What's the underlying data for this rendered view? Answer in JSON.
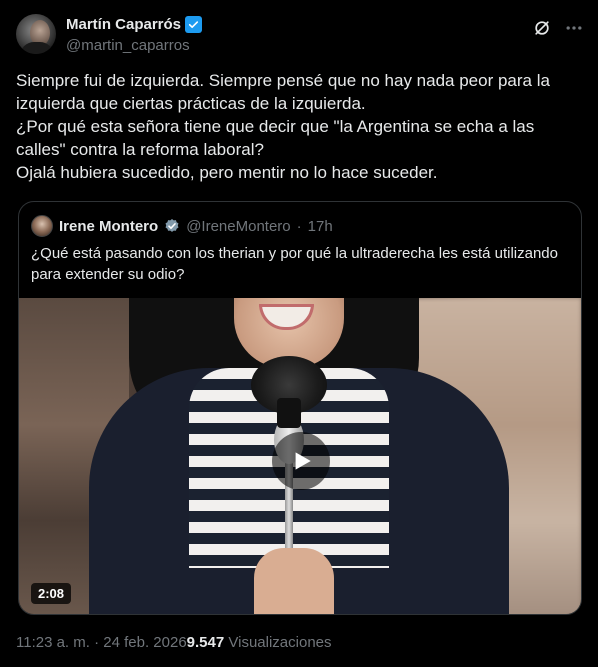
{
  "author": {
    "display_name": "Martín Caparrós",
    "handle": "@martin_caparros"
  },
  "tweet": {
    "lines": [
      "Siempre fui de izquierda. Siempre pensé que no hay nada peor para la izquierda que ciertas prácticas de la izquierda.",
      "¿Por qué esta señora tiene que decir que \"la Argentina se echa a las calles\" contra la reforma laboral?",
      "Ojalá hubiera sucedido, pero mentir no lo hace suceder."
    ]
  },
  "quoted": {
    "display_name": "Irene Montero",
    "handle": "@IreneMontero",
    "separator": "·",
    "time": "17h",
    "text": "¿Qué está pasando con los therian y por qué la ultraderecha les está utilizando para extender su odio?",
    "video": {
      "duration": "2:08"
    }
  },
  "footer": {
    "timestamp": "11:23 a. m. · 24 feb. 2026",
    "views_count": "9.547",
    "views_label": "Visualizaciones"
  },
  "icons": {
    "verified": "verified-badge-icon",
    "grok": "grok-icon",
    "more": "more-options-icon",
    "play": "play-icon"
  },
  "colors": {
    "background": "#000000",
    "text": "#e7e9ea",
    "muted": "#71767b",
    "verified_blue": "#1d9bf0",
    "verified_gray": "#829aab",
    "border": "#2f3336"
  }
}
